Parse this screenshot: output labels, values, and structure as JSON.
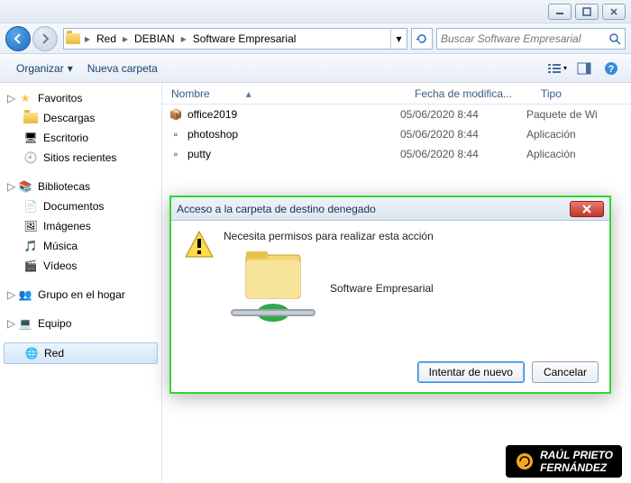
{
  "window": {
    "breadcrumb": [
      "Red",
      "DEBIAN",
      "Software Empresarial"
    ],
    "search_placeholder": "Buscar Software Empresarial"
  },
  "toolbar": {
    "organize": "Organizar",
    "new_folder": "Nueva carpeta"
  },
  "sidebar": {
    "favorites": {
      "label": "Favoritos",
      "items": [
        "Descargas",
        "Escritorio",
        "Sitios recientes"
      ]
    },
    "libraries": {
      "label": "Bibliotecas",
      "items": [
        "Documentos",
        "Imágenes",
        "Música",
        "Vídeos"
      ]
    },
    "homegroup": {
      "label": "Grupo en el hogar"
    },
    "computer": {
      "label": "Equipo"
    },
    "network": {
      "label": "Red"
    }
  },
  "columns": {
    "name": "Nombre",
    "date": "Fecha de modifica...",
    "type": "Tipo"
  },
  "files": [
    {
      "name": "office2019",
      "date": "05/06/2020 8:44",
      "type": "Paquete de Wi"
    },
    {
      "name": "photoshop",
      "date": "05/06/2020 8:44",
      "type": "Aplicación"
    },
    {
      "name": "putty",
      "date": "05/06/2020 8:44",
      "type": "Aplicación"
    }
  ],
  "dialog": {
    "title": "Acceso a la carpeta de destino denegado",
    "message": "Necesita permisos para realizar esta acción",
    "folder_name": "Software Empresarial",
    "retry": "Intentar de nuevo",
    "cancel": "Cancelar"
  },
  "watermark": {
    "line1": "RAÚL PRIETO",
    "line2": "FERNÁNDEZ"
  }
}
